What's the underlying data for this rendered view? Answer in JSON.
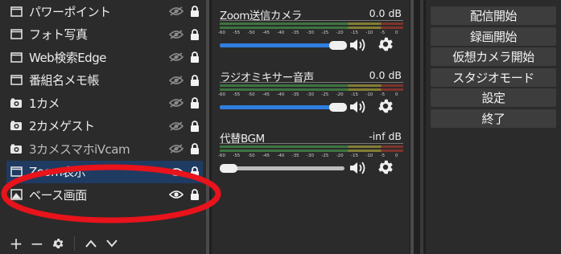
{
  "sources": {
    "items": [
      {
        "name": "パワーポイント",
        "type_icon": "window-capture-icon",
        "visible": false,
        "locked": true
      },
      {
        "name": "フォト写真",
        "type_icon": "window-capture-icon",
        "visible": false,
        "locked": true
      },
      {
        "name": "Web検索Edge",
        "type_icon": "window-capture-icon",
        "visible": false,
        "locked": true
      },
      {
        "name": "番組名メモ帳",
        "type_icon": "window-capture-icon",
        "visible": false,
        "locked": true
      },
      {
        "name": "1カメ",
        "type_icon": "camera-icon",
        "visible": false,
        "locked": true
      },
      {
        "name": "2カメゲスト",
        "type_icon": "camera-icon",
        "visible": false,
        "locked": true
      },
      {
        "name": "3カメスマホiVcam",
        "type_icon": "camera-icon",
        "visible": false,
        "locked": true
      },
      {
        "name": "Zoom表示",
        "type_icon": "window-capture-icon",
        "visible": true,
        "locked": true,
        "selected": true
      },
      {
        "name": "ベース画面",
        "type_icon": "image-icon",
        "visible": true,
        "locked": true
      }
    ],
    "toolbar": {
      "add": "+",
      "remove": "−",
      "settings": "gear-icon",
      "up": "chevron-up-icon",
      "down": "chevron-down-icon"
    }
  },
  "mixer": {
    "channels": [
      {
        "name": "Zoom送信カメラ",
        "db": "0.0 dB",
        "volume": 0.95
      },
      {
        "name": "ラジオミキサー音声",
        "db": "0.0 dB",
        "volume": 0.95
      },
      {
        "name": "代替BGM",
        "db": "-inf dB",
        "volume": 0.05
      }
    ],
    "scale_ticks": [
      "-60",
      "-55",
      "-50",
      "-45",
      "-40",
      "-35",
      "-30",
      "-25",
      "-20",
      "-15",
      "-10",
      "-5",
      "0"
    ]
  },
  "controls": {
    "buttons": [
      "配信開始",
      "録画開始",
      "仮想カメラ開始",
      "スタジオモード",
      "設定",
      "終了"
    ]
  },
  "colors": {
    "selected_row": "#1f3b62",
    "slider_fill": "#2f7fe0",
    "meter_green": "#4caf50",
    "meter_yellow": "#c9c23a",
    "meter_red": "#c0392b",
    "annotation": "#e8131b"
  }
}
